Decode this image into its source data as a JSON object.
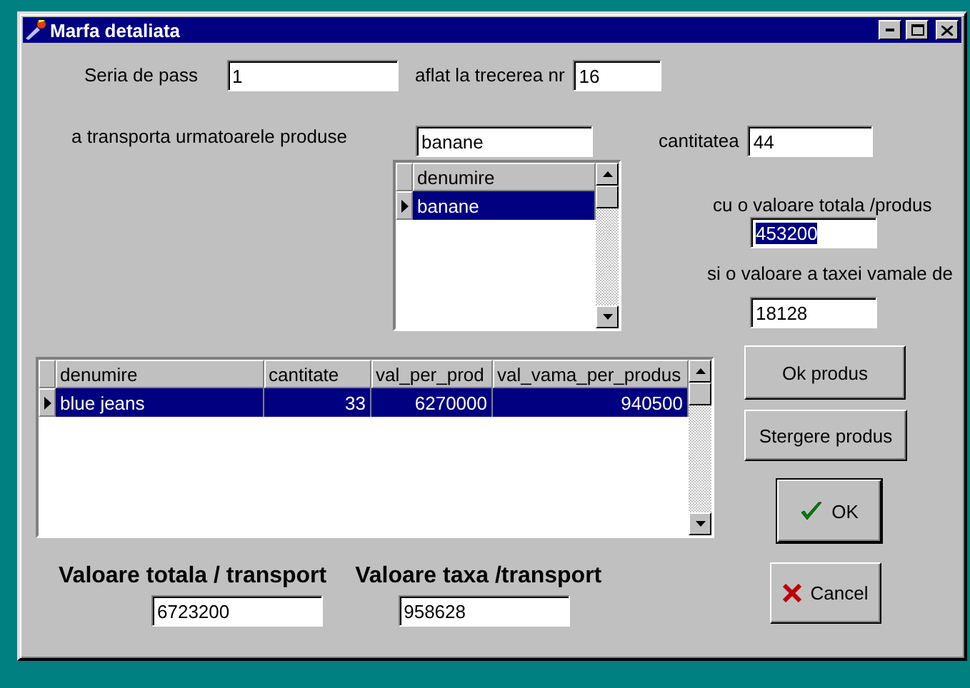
{
  "window": {
    "title": "Marfa detaliata"
  },
  "pass_series": {
    "label": "Seria de pass",
    "value": "1"
  },
  "crossing": {
    "label": "aflat la trecerea nr",
    "value": "16"
  },
  "products_label": "a transporta urmatoarele produse",
  "product_field": {
    "value": "banane"
  },
  "product_list": {
    "column": "denumire",
    "rows": [
      {
        "name": "banane",
        "selected": true
      }
    ]
  },
  "quantity": {
    "label": "cantitatea",
    "value": "44"
  },
  "total_value": {
    "label": "cu o valoare totala /produs",
    "value": "453200",
    "text_selected": true
  },
  "customs_value": {
    "label": "si o valoare a taxei vamale de",
    "value": "18128",
    "text_selected": false
  },
  "items_table": {
    "columns": [
      "denumire",
      "cantitate",
      "val_per_prod",
      "val_vama_per_produs"
    ],
    "rows": [
      {
        "cells": [
          "blue jeans",
          "33",
          "6270000",
          "940500"
        ],
        "selected": true
      }
    ]
  },
  "buttons": [
    {
      "label": "Ok produs",
      "kind": "plain"
    },
    {
      "label": "Stergere produs",
      "kind": "plain"
    },
    {
      "label": "OK",
      "kind": "ok"
    },
    {
      "label": "Cancel",
      "kind": "cancel"
    }
  ],
  "totals": [
    {
      "label": "Valoare totala / transport",
      "value": "6723200"
    },
    {
      "label": "Valoare taxa /transport",
      "value": "958628"
    }
  ]
}
